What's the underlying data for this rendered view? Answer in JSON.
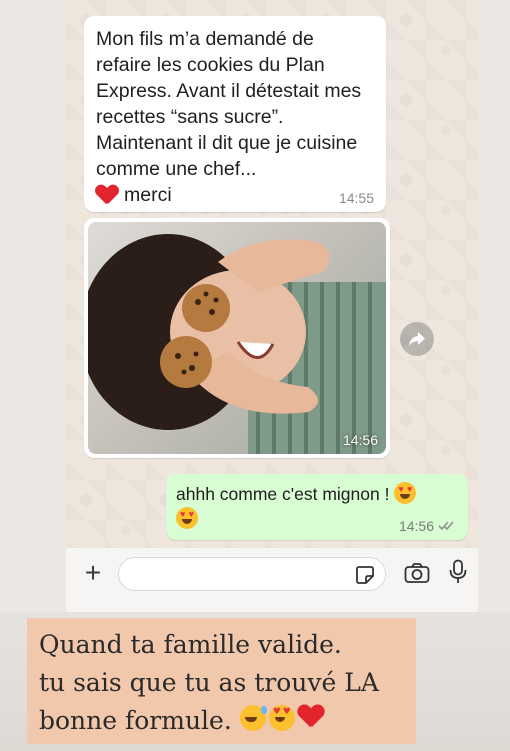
{
  "messages": {
    "incoming_text": {
      "body": "Mon fils m’a demandé de\nrefaire les cookies du Plan\nExpress. Avant il détestait mes\nrecettes “sans sucre”.\nMaintenant il dit que je cuisine\ncomme une chef...",
      "heart_suffix": "merci",
      "time": "14:55"
    },
    "incoming_photo": {
      "time": "14:56",
      "subject": "child-with-cookies-photo"
    },
    "outgoing_text": {
      "body": "ahhh comme c'est mignon !",
      "time": "14:56",
      "status": "read"
    }
  },
  "input_bar": {
    "placeholder": ""
  },
  "caption": {
    "line1": "Quand ta famille valide.",
    "line2": "tu sais que tu as trouvé LA",
    "line3": "bonne formule."
  },
  "colors": {
    "outgoing_bubble": "#d9fdd3",
    "incoming_bubble": "#ffffff",
    "read_tick": "#53bdeb",
    "caption_bg": "#f2c8ad"
  },
  "icons": [
    "plus-icon",
    "sticker-icon",
    "camera-icon",
    "microphone-icon",
    "forward-icon",
    "double-check-icon"
  ]
}
